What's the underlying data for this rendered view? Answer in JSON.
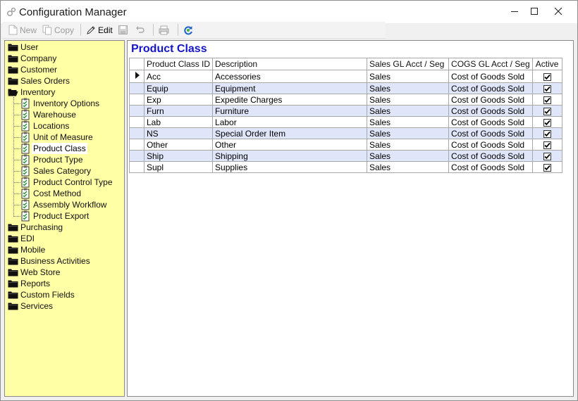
{
  "window": {
    "title": "Configuration Manager"
  },
  "toolbar": {
    "new_label": "New",
    "copy_label": "Copy",
    "edit_label": "Edit"
  },
  "tree": {
    "items": [
      {
        "label": "User",
        "type": "folder",
        "level": 0
      },
      {
        "label": "Company",
        "type": "folder",
        "level": 0
      },
      {
        "label": "Customer",
        "type": "folder",
        "level": 0
      },
      {
        "label": "Sales Orders",
        "type": "folder",
        "level": 0
      },
      {
        "label": "Inventory",
        "type": "folder-open",
        "level": 0
      },
      {
        "label": "Inventory Options",
        "type": "doc",
        "level": 1
      },
      {
        "label": "Warehouse",
        "type": "doc",
        "level": 1
      },
      {
        "label": "Locations",
        "type": "doc",
        "level": 1
      },
      {
        "label": "Unit of Measure",
        "type": "doc",
        "level": 1
      },
      {
        "label": "Product Class",
        "type": "doc",
        "level": 1,
        "selected": true
      },
      {
        "label": "Product Type",
        "type": "doc",
        "level": 1
      },
      {
        "label": "Sales Category",
        "type": "doc",
        "level": 1
      },
      {
        "label": "Product Control Type",
        "type": "doc",
        "level": 1
      },
      {
        "label": "Cost Method",
        "type": "doc",
        "level": 1
      },
      {
        "label": "Assembly Workflow",
        "type": "doc",
        "level": 1
      },
      {
        "label": "Product Export",
        "type": "doc",
        "level": 1
      },
      {
        "label": "Purchasing",
        "type": "folder",
        "level": 0
      },
      {
        "label": "EDI",
        "type": "folder",
        "level": 0
      },
      {
        "label": "Mobile",
        "type": "folder",
        "level": 0
      },
      {
        "label": "Business Activities",
        "type": "folder",
        "level": 0
      },
      {
        "label": "Web Store",
        "type": "folder",
        "level": 0
      },
      {
        "label": "Reports",
        "type": "folder",
        "level": 0
      },
      {
        "label": "Custom Fields",
        "type": "folder",
        "level": 0
      },
      {
        "label": "Services",
        "type": "folder",
        "level": 0
      }
    ]
  },
  "main": {
    "title": "Product Class",
    "columns": [
      "Product Class ID",
      "Description",
      "Sales GL Acct / Seg",
      "COGS GL Acct / Seg",
      "Active"
    ],
    "rows": [
      {
        "id": "Acc",
        "description": "Accessories",
        "sales_gl": "Sales",
        "cogs_gl": "Cost of Goods Sold",
        "active": true,
        "current": true
      },
      {
        "id": "Equip",
        "description": "Equipment",
        "sales_gl": "Sales",
        "cogs_gl": "Cost of Goods Sold",
        "active": true
      },
      {
        "id": "Exp",
        "description": "Expedite Charges",
        "sales_gl": "Sales",
        "cogs_gl": "Cost of Goods Sold",
        "active": true
      },
      {
        "id": "Furn",
        "description": "Furniture",
        "sales_gl": "Sales",
        "cogs_gl": "Cost of Goods Sold",
        "active": true
      },
      {
        "id": "Lab",
        "description": "Labor",
        "sales_gl": "Sales",
        "cogs_gl": "Cost of Goods Sold",
        "active": true
      },
      {
        "id": "NS",
        "description": "Special Order Item",
        "sales_gl": "Sales",
        "cogs_gl": "Cost of Goods Sold",
        "active": true
      },
      {
        "id": "Other",
        "description": "Other",
        "sales_gl": "Sales",
        "cogs_gl": "Cost of Goods Sold",
        "active": true
      },
      {
        "id": "Ship",
        "description": "Shipping",
        "sales_gl": "Sales",
        "cogs_gl": "Cost of Goods Sold",
        "active": true
      },
      {
        "id": "Supl",
        "description": "Supplies",
        "sales_gl": "Sales",
        "cogs_gl": "Cost of Goods Sold",
        "active": true
      }
    ]
  },
  "colors": {
    "tree_background": "#ffffa6",
    "title_accent": "#1515c8",
    "row_alt": "#dfe6fa"
  }
}
